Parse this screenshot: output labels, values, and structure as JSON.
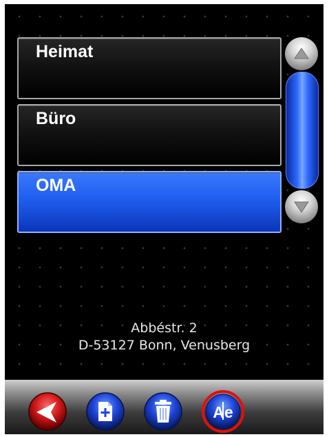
{
  "locations": [
    {
      "label": "Heimat",
      "selected": false
    },
    {
      "label": "Büro",
      "selected": false
    },
    {
      "label": "OMA",
      "selected": true
    }
  ],
  "address": {
    "line1": "Abbéstr. 2",
    "line2": "D-53127 Bonn, Venusberg"
  },
  "toolbar": {
    "buttons": [
      "back-icon",
      "new-document-icon",
      "trash-icon",
      "rename-icon"
    ],
    "rename_icon_text": "Ae"
  },
  "colors": {
    "selected": "#1f5ef0",
    "back_button": "#d01818",
    "action_buttons": "#1e44d8",
    "highlight_ring": "#e01010"
  }
}
